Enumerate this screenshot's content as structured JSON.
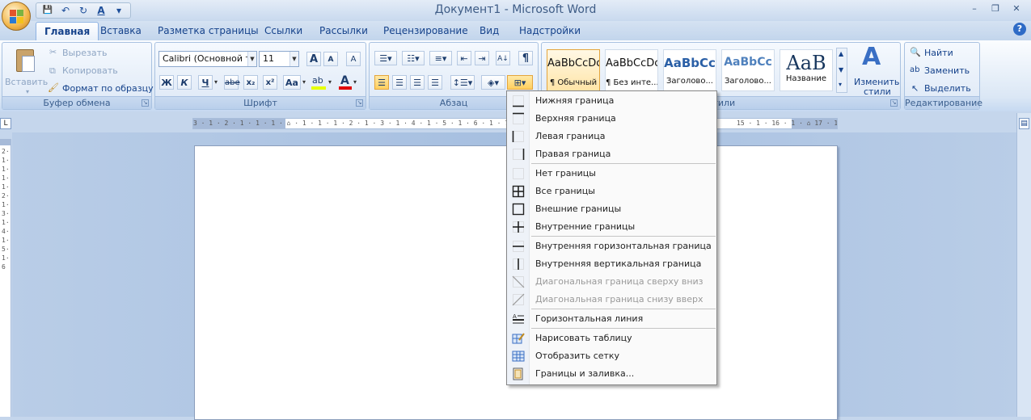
{
  "window": {
    "title": "Документ1 - Microsoft Word",
    "controls": [
      "–",
      "❐",
      "✕"
    ]
  },
  "qat": {
    "icons": [
      "save-icon",
      "undo-icon",
      "redo-icon",
      "spelling-icon",
      "customize-icon"
    ],
    "save": "💾",
    "undo": "↶",
    "redo": "↻",
    "spell": "A",
    "more": "▾"
  },
  "tabs": [
    "Главная",
    "Вставка",
    "Разметка страницы",
    "Ссылки",
    "Рассылки",
    "Рецензирование",
    "Вид",
    "Надстройки"
  ],
  "help": "?",
  "clipboard": {
    "paste": "Вставить",
    "cut": "Вырезать",
    "copy": "Копировать",
    "format_painter": "Формат по образцу",
    "label": "Буфер обмена"
  },
  "font": {
    "family": "Calibri (Основной те",
    "size": "11",
    "grow": "A",
    "shrink": "A",
    "clear": "A",
    "bold": "Ж",
    "italic": "К",
    "underline": "Ч",
    "strike": "abe",
    "sub": "x₂",
    "sup": "x²",
    "case": "Aa",
    "highlight": "ab",
    "color": "A",
    "label": "Шрифт",
    "highlight_color": "#e6ff00",
    "font_color": "#e00000"
  },
  "paragraph": {
    "label": "Абзац",
    "pilcrow": "¶",
    "sort": "A↓"
  },
  "styles": {
    "tiles": [
      {
        "sample": "AaBbCcDc",
        "name": "¶ Обычный"
      },
      {
        "sample": "AaBbCcDc",
        "name": "¶ Без инте..."
      },
      {
        "sample": "AaBbCc",
        "name": "Заголово..."
      },
      {
        "sample": "AaBbCc",
        "name": "Заголово..."
      },
      {
        "sample": "AaB",
        "name": "Название"
      }
    ],
    "change_line1": "Изменить",
    "change_line2": "стили",
    "label": "Стили"
  },
  "editing": {
    "find": "Найти",
    "replace": "Заменить",
    "select": "Выделить",
    "label": "Редактирование"
  },
  "ruler": {
    "numbers": "3 · 1 · 2 · 1 · 1 · 1 · ⌂ · 1 · 1 · 1 · 2 · 1 · 3 · 1 · 4 · 1 · 5 · 1 · 6 · 1 · 7 ·",
    "numbers_right": "15 · 1 · 16 · 1 · ⌂ 17 · 1 ·",
    "tab_selector": "L",
    "vertical": "2·1·1·1·1·2·1·3·1·4·1·5·1·6"
  },
  "menu": {
    "items": [
      {
        "label": "Нижняя граница",
        "icon": "bottom-border-icon",
        "disabled": false
      },
      {
        "label": "Верхняя граница",
        "icon": "top-border-icon",
        "disabled": false
      },
      {
        "label": "Левая граница",
        "icon": "left-border-icon",
        "disabled": false
      },
      {
        "label": "Правая граница",
        "icon": "right-border-icon",
        "disabled": false
      },
      {
        "label": "Нет границы",
        "icon": "no-border-icon",
        "disabled": false
      },
      {
        "label": "Все границы",
        "icon": "all-borders-icon",
        "disabled": false
      },
      {
        "label": "Внешние границы",
        "icon": "outside-borders-icon",
        "disabled": false
      },
      {
        "label": "Внутренние границы",
        "icon": "inside-borders-icon",
        "disabled": false
      },
      {
        "label": "Внутренняя горизонтальная граница",
        "icon": "inside-horizontal-border-icon",
        "disabled": false
      },
      {
        "label": "Внутренняя вертикальная граница",
        "icon": "inside-vertical-border-icon",
        "disabled": false
      },
      {
        "label": "Диагональная граница сверху вниз",
        "icon": "diagonal-down-border-icon",
        "disabled": true
      },
      {
        "label": "Диагональная граница снизу вверх",
        "icon": "diagonal-up-border-icon",
        "disabled": true
      },
      {
        "label": "Горизонтальная линия",
        "icon": "horizontal-line-icon",
        "disabled": false
      },
      {
        "label": "Нарисовать таблицу",
        "icon": "draw-table-icon",
        "disabled": false
      },
      {
        "label": "Отобразить сетку",
        "icon": "view-gridlines-icon",
        "disabled": false
      },
      {
        "label": "Границы и заливка...",
        "icon": "borders-shading-icon",
        "disabled": false
      }
    ]
  },
  "colors": {
    "accent": "#15428b",
    "selected_style": "#ffe5a8"
  }
}
